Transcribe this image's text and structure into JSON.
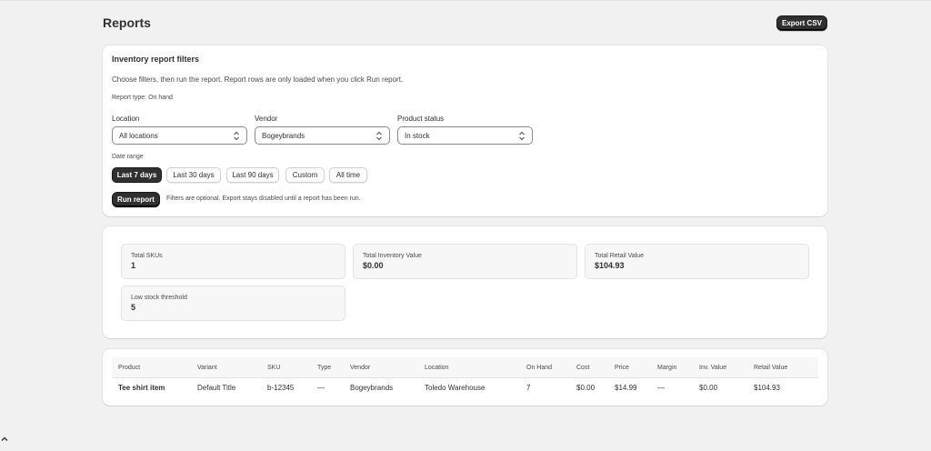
{
  "page": {
    "title": "Reports",
    "export_label": "Export CSV"
  },
  "filters": {
    "title": "Inventory report filters",
    "help": "Choose filters, then run the report. Report rows are only loaded when you click Run report.",
    "report_type": "Report type: On hand",
    "location": {
      "label": "Location",
      "value": "All locations"
    },
    "vendor": {
      "label": "Vendor",
      "value": "Bogeybrands"
    },
    "status": {
      "label": "Product status",
      "value": "In stock"
    },
    "date_range_label": "Date range",
    "date_options": [
      "Last 7 days",
      "Last 30 days",
      "Last 90 days",
      "Custom",
      "All time"
    ],
    "selected_date_option": "Last 7 days",
    "run_label": "Run report",
    "run_note": "Filters are optional. Export stays disabled until a report has been run."
  },
  "stats": [
    {
      "label": "Total SKUs",
      "value": "1"
    },
    {
      "label": "Total Inventory Value",
      "value": "$0.00"
    },
    {
      "label": "Total Retail Value",
      "value": "$104.93"
    },
    {
      "label": "Low stock threshold",
      "value": "5"
    }
  ],
  "table": {
    "columns": [
      "Product",
      "Variant",
      "SKU",
      "Type",
      "Vendor",
      "Location",
      "On Hand",
      "Cost",
      "Price",
      "Margin",
      "Inv. Value",
      "Retail Value"
    ],
    "rows": [
      [
        "Tee shirt item",
        "Default Title",
        "b-12345",
        "—",
        "Bogeybrands",
        "Toledo Warehouse",
        "7",
        "$0.00",
        "$14.99",
        "—",
        "$0.00",
        "$104.93"
      ]
    ]
  },
  "colors": {
    "primary_button": "#303030",
    "page_bg": "#f1f1f1",
    "card_bg": "#ffffff"
  },
  "icons": {
    "select_chevron": "chevron-up-down-icon",
    "corner": "chevron-up-icon"
  }
}
